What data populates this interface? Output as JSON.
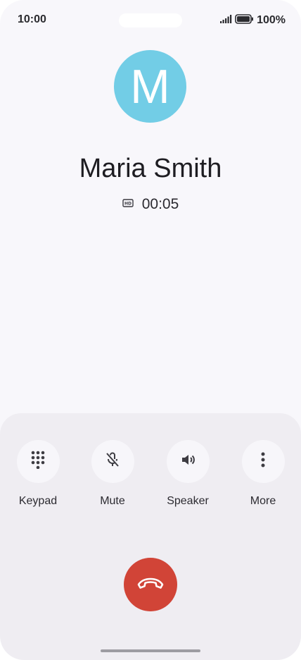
{
  "status_bar": {
    "time": "10:00",
    "battery": "100%",
    "signal_icon": "signal-icon",
    "battery_icon": "battery-icon"
  },
  "caller": {
    "initial": "M",
    "name": "Maria Smith",
    "avatar_color": "#72cde6",
    "hd_icon": "hd-icon",
    "duration": "00:05"
  },
  "controls": {
    "keypad": {
      "label": "Keypad",
      "icon": "keypad-icon"
    },
    "mute": {
      "label": "Mute",
      "icon": "mic-off-icon"
    },
    "speaker": {
      "label": "Speaker",
      "icon": "speaker-icon"
    },
    "more": {
      "label": "More",
      "icon": "more-vertical-icon"
    }
  },
  "end_call": {
    "icon": "end-call-icon",
    "color": "#d14437"
  }
}
